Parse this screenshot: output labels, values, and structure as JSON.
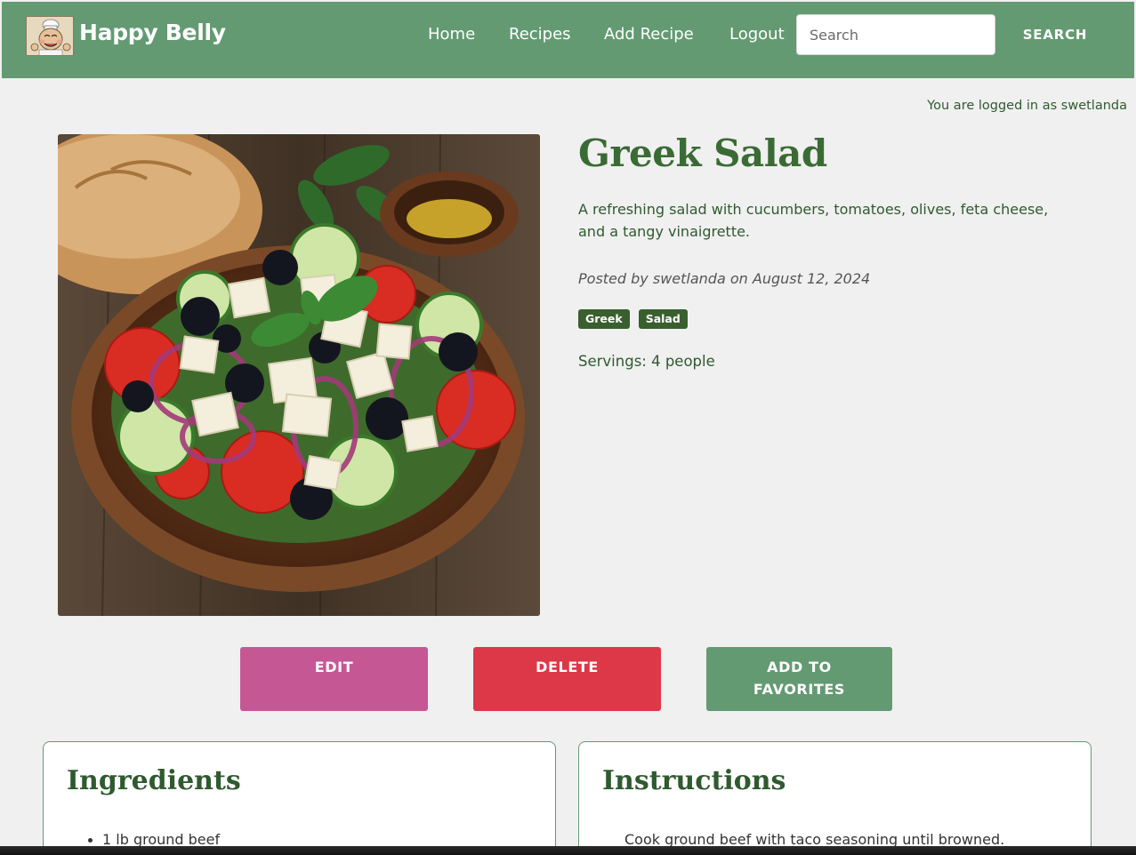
{
  "navbar": {
    "logo_icon": "chef-logo-icon",
    "brand": "Happy Belly",
    "links": [
      "Home",
      "Recipes",
      "Add Recipe",
      "Logout"
    ],
    "search": {
      "placeholder": "Search",
      "value": ""
    },
    "search_button": "SEARCH",
    "bg_color": "#639a72"
  },
  "user": {
    "status": "You are logged in as swetlanda"
  },
  "recipe": {
    "image_icon": "greek-salad-photo",
    "title": "Greek Salad",
    "description": "A refreshing salad with cucumbers, tomatoes, olives, feta cheese, and a tangy vinaigrette.",
    "posted_prefix": "Posted by",
    "author": "swetlanda",
    "posted_mid": "on",
    "date": "August 12, 2024",
    "tags": [
      "Greek",
      "Salad"
    ],
    "servings": "Servings: 4 people"
  },
  "actions": {
    "edit": "EDIT",
    "delete": "DELETE",
    "favorites": "ADD TO FAVORITES",
    "colors": {
      "edit": "#c65795",
      "delete": "#dc3848",
      "favorites": "#639a72"
    }
  },
  "ingredients": {
    "title": "Ingredients",
    "items": [
      "1 lb ground beef"
    ]
  },
  "instructions": {
    "title": "Instructions",
    "items": [
      "Cook ground beef with taco seasoning until browned."
    ]
  }
}
